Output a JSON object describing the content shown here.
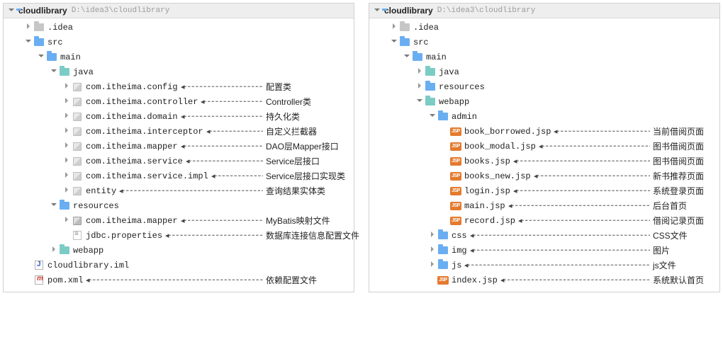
{
  "left": {
    "header": {
      "name": "cloudlibrary",
      "path": "D:\\idea3\\cloudlibrary"
    },
    "rows": [
      {
        "indent": 1,
        "chev": "right",
        "icon": "fld-gray",
        "label": ".idea",
        "inter": true
      },
      {
        "indent": 1,
        "chev": "down",
        "icon": "fld-blue",
        "label": "src",
        "inter": true
      },
      {
        "indent": 2,
        "chev": "down",
        "icon": "fld-blue",
        "label": "main",
        "inter": true
      },
      {
        "indent": 3,
        "chev": "down",
        "icon": "fld-teal",
        "label": "java",
        "inter": true
      },
      {
        "indent": 4,
        "chev": "right",
        "icon": "pkg",
        "label": "com.itheima.config",
        "annot": "配置类",
        "inter": true
      },
      {
        "indent": 4,
        "chev": "right",
        "icon": "pkg",
        "label": "com.itheima.controller",
        "annot": "Controller类",
        "inter": true
      },
      {
        "indent": 4,
        "chev": "right",
        "icon": "pkg",
        "label": "com.itheima.domain",
        "annot": "持久化类",
        "inter": true
      },
      {
        "indent": 4,
        "chev": "right",
        "icon": "pkg",
        "label": "com.itheima.interceptor",
        "annot": "自定义拦截器",
        "inter": true
      },
      {
        "indent": 4,
        "chev": "right",
        "icon": "pkg",
        "label": "com.itheima.mapper",
        "annot": "DAO层Mapper接口",
        "inter": true
      },
      {
        "indent": 4,
        "chev": "right",
        "icon": "pkg",
        "label": "com.itheima.service",
        "annot": "Service层接口",
        "inter": true
      },
      {
        "indent": 4,
        "chev": "right",
        "icon": "pkg",
        "label": "com.itheima.service.impl",
        "annot": "Service层接口实现类",
        "inter": true
      },
      {
        "indent": 4,
        "chev": "right",
        "icon": "pkg",
        "label": "entity",
        "annot": "查询结果实体类",
        "inter": true
      },
      {
        "indent": 3,
        "chev": "down",
        "icon": "fld-blue",
        "label": "resources",
        "inter": true
      },
      {
        "indent": 4,
        "chev": "right",
        "icon": "pkg dark",
        "label": "com.itheima.mapper",
        "annot": "MyBatis映射文件",
        "inter": true
      },
      {
        "indent": 4,
        "chev": "",
        "icon": "file-prop",
        "label": "jdbc.properties",
        "annot": "数据库连接信息配置文件",
        "inter": true
      },
      {
        "indent": 3,
        "chev": "right",
        "icon": "fld-teal",
        "label": "webapp",
        "inter": true
      },
      {
        "indent": 1,
        "chev": "",
        "icon": "file-iml",
        "label": "cloudlibrary.iml",
        "inter": true
      },
      {
        "indent": 1,
        "chev": "",
        "icon": "file-xml",
        "label": "pom.xml",
        "annot": "依赖配置文件",
        "inter": true
      }
    ],
    "annotX": 370
  },
  "right": {
    "header": {
      "name": "cloudlibrary",
      "path": "D:\\idea3\\cloudlibrary"
    },
    "rows": [
      {
        "indent": 1,
        "chev": "right",
        "icon": "fld-gray",
        "label": ".idea",
        "inter": true
      },
      {
        "indent": 1,
        "chev": "down",
        "icon": "fld-blue",
        "label": "src",
        "inter": true
      },
      {
        "indent": 2,
        "chev": "down",
        "icon": "fld-blue",
        "label": "main",
        "inter": true
      },
      {
        "indent": 3,
        "chev": "right",
        "icon": "fld-teal",
        "label": "java",
        "inter": true
      },
      {
        "indent": 3,
        "chev": "right",
        "icon": "fld-blue",
        "label": "resources",
        "inter": true
      },
      {
        "indent": 3,
        "chev": "down",
        "icon": "fld-teal",
        "label": "webapp",
        "inter": true
      },
      {
        "indent": 4,
        "chev": "down",
        "icon": "fld-blue",
        "label": "admin",
        "inter": true
      },
      {
        "indent": 5,
        "chev": "",
        "icon": "file-jsp",
        "label": "book_borrowed.jsp",
        "annot": "当前借阅页面",
        "inter": true
      },
      {
        "indent": 5,
        "chev": "",
        "icon": "file-jsp",
        "label": "book_modal.jsp",
        "annot": "图书借阅页面",
        "inter": true
      },
      {
        "indent": 5,
        "chev": "",
        "icon": "file-jsp",
        "label": "books.jsp",
        "annot": "图书借阅页面",
        "inter": true
      },
      {
        "indent": 5,
        "chev": "",
        "icon": "file-jsp",
        "label": "books_new.jsp",
        "annot": "新书推荐页面",
        "inter": true
      },
      {
        "indent": 5,
        "chev": "",
        "icon": "file-jsp",
        "label": "login.jsp",
        "annot": "系统登录页面",
        "inter": true
      },
      {
        "indent": 5,
        "chev": "",
        "icon": "file-jsp",
        "label": "main.jsp",
        "annot": "后台首页",
        "inter": true
      },
      {
        "indent": 5,
        "chev": "",
        "icon": "file-jsp",
        "label": "record.jsp",
        "annot": "借阅记录页面",
        "inter": true
      },
      {
        "indent": 4,
        "chev": "right",
        "icon": "fld-blue",
        "label": "css",
        "annot": "CSS文件",
        "inter": true
      },
      {
        "indent": 4,
        "chev": "right",
        "icon": "fld-blue",
        "label": "img",
        "annot": "图片",
        "inter": true
      },
      {
        "indent": 4,
        "chev": "right",
        "icon": "fld-blue",
        "label": "js",
        "annot": "js文件",
        "inter": true
      },
      {
        "indent": 4,
        "chev": "",
        "icon": "file-jsp",
        "label": "index.jsp",
        "annot": "系统默认首页",
        "inter": true
      }
    ],
    "annotX": 400
  }
}
